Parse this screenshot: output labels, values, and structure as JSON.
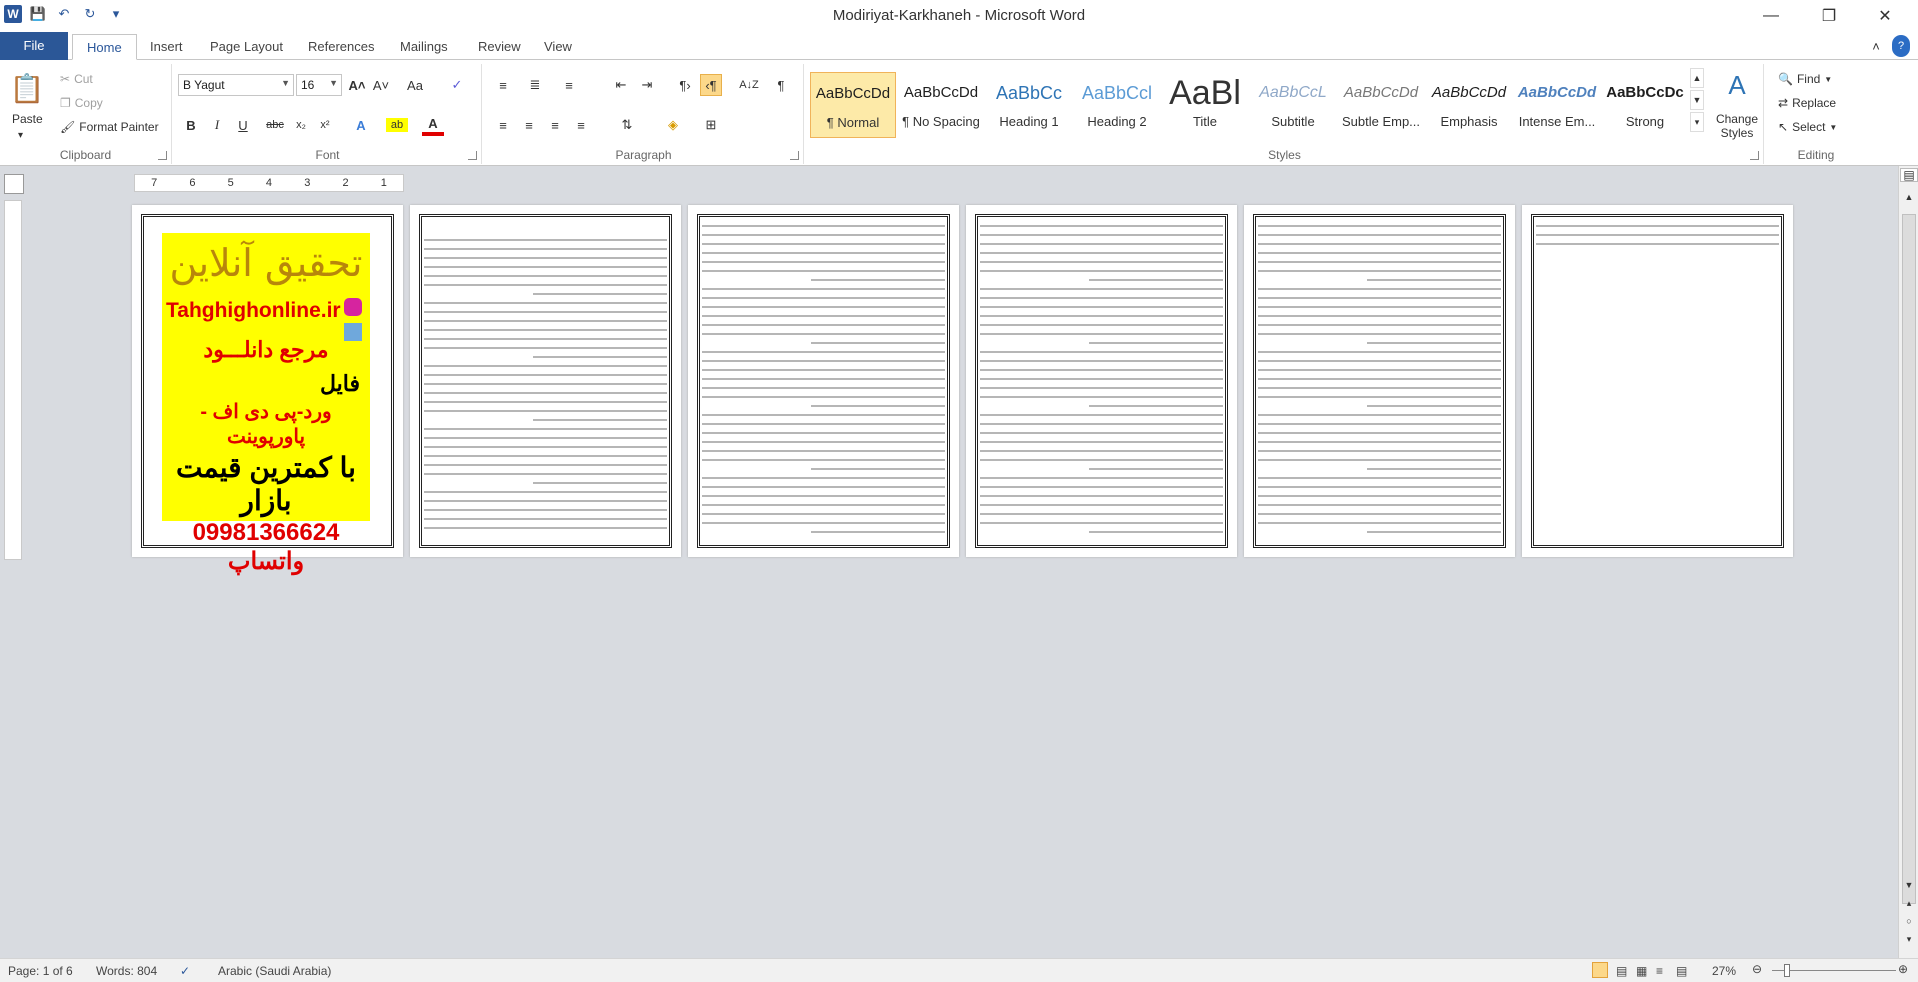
{
  "window": {
    "title": "Modiriyat-Karkhaneh  -  Microsoft Word",
    "app_icon": "W"
  },
  "tabs": [
    "File",
    "Home",
    "Insert",
    "Page Layout",
    "References",
    "Mailings",
    "Review",
    "View"
  ],
  "active_tab": "Home",
  "clipboard": {
    "label": "Clipboard",
    "paste": "Paste",
    "cut": "Cut",
    "copy": "Copy",
    "format_painter": "Format Painter"
  },
  "font": {
    "label": "Font",
    "name": "B Yagut",
    "size": "16"
  },
  "paragraph": {
    "label": "Paragraph"
  },
  "styles": {
    "label": "Styles",
    "items": [
      {
        "preview": "AaBbCcDd",
        "name": "¶ Normal"
      },
      {
        "preview": "AaBbCcDd",
        "name": "¶ No Spacing"
      },
      {
        "preview": "AaBbCc",
        "name": "Heading 1"
      },
      {
        "preview": "AaBbCcl",
        "name": "Heading 2"
      },
      {
        "preview": "AaBl",
        "name": "Title"
      },
      {
        "preview": "AaBbCcL",
        "name": "Subtitle"
      },
      {
        "preview": "AaBbCcDd",
        "name": "Subtle Emp..."
      },
      {
        "preview": "AaBbCcDd",
        "name": "Emphasis"
      },
      {
        "preview": "AaBbCcDd",
        "name": "Intense Em..."
      },
      {
        "preview": "AaBbCcDc",
        "name": "Strong"
      }
    ],
    "change_styles_line1": "Change",
    "change_styles_line2": "Styles"
  },
  "editing": {
    "label": "Editing",
    "find": "Find",
    "replace": "Replace",
    "select": "Select"
  },
  "ruler_numbers": [
    "7",
    "6",
    "5",
    "4",
    "3",
    "2",
    "1"
  ],
  "cover": {
    "line1": "تحقیق آنلاین",
    "line2": "Tahghighonline.ir",
    "line3": "مرجع دانلـــود",
    "line4": "فایل",
    "line5": "ورد-پی دی اف - پاورپوینت",
    "line6": "با کمترین قیمت بازار",
    "line7": "09981366624 واتساپ"
  },
  "status": {
    "page": "Page: 1 of 6",
    "words": "Words: 804",
    "language": "Arabic (Saudi Arabia)",
    "zoom": "27%"
  }
}
